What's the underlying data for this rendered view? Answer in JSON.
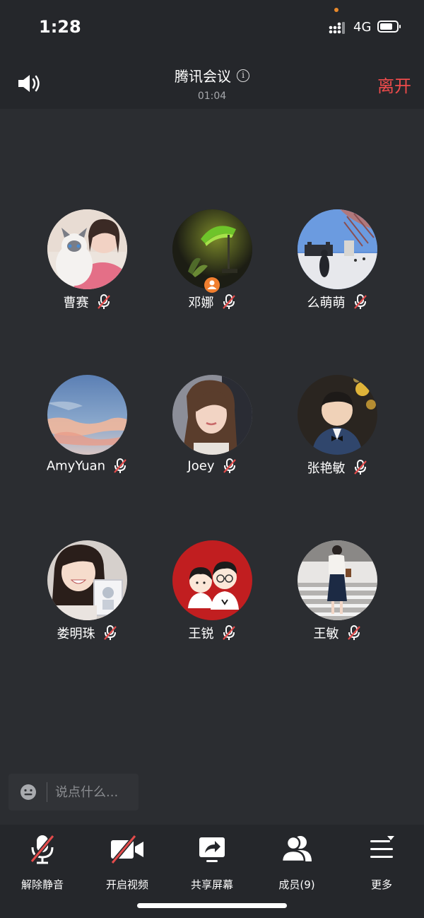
{
  "status_bar": {
    "time": "1:28",
    "network": "4G"
  },
  "header": {
    "title": "腾讯会议",
    "info_icon_glyph": "i",
    "timer": "01:04",
    "leave_label": "离开"
  },
  "participants": [
    {
      "name": "曹赛",
      "muted": true,
      "host": false
    },
    {
      "name": "邓娜",
      "muted": true,
      "host": true
    },
    {
      "name": "么萌萌",
      "muted": true,
      "host": false
    },
    {
      "name": "AmyYuan",
      "muted": true,
      "host": false
    },
    {
      "name": "Joey",
      "muted": true,
      "host": false
    },
    {
      "name": "张艳敏",
      "muted": true,
      "host": false
    },
    {
      "name": "娄明珠",
      "muted": true,
      "host": false
    },
    {
      "name": "王锐",
      "muted": true,
      "host": false
    },
    {
      "name": "王敏",
      "muted": true,
      "host": false
    }
  ],
  "chat": {
    "placeholder": "说点什么..."
  },
  "toolbar": {
    "unmute_label": "解除静音",
    "video_label": "开启视频",
    "share_label": "共享屏幕",
    "members_label": "成员(9)",
    "more_label": "更多"
  },
  "colors": {
    "accent_red": "#ee4b4b",
    "host_badge": "#f17f2f",
    "background": "#2b2d31"
  }
}
